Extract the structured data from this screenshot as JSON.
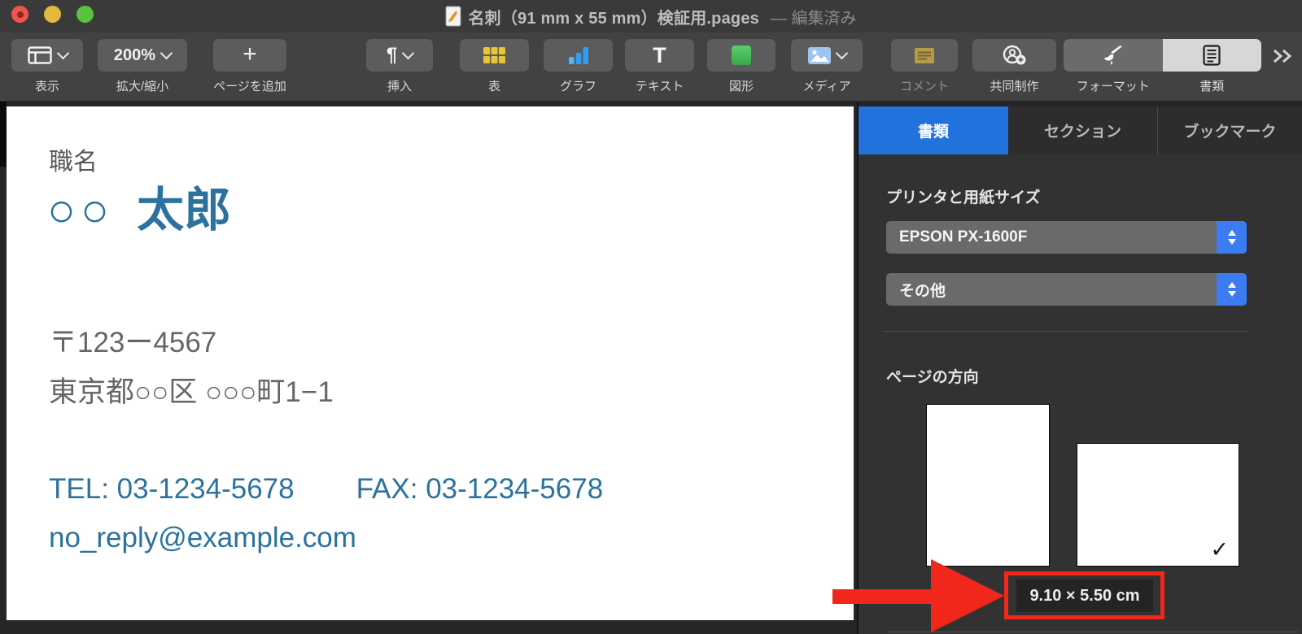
{
  "window": {
    "title": "名刺（91 mm x 55 mm）検証用.pages",
    "edited_suffix": "— 編集済み"
  },
  "toolbar": {
    "view": {
      "label": "表示"
    },
    "zoom": {
      "label": "拡大/縮小",
      "value": "200%"
    },
    "add_page": {
      "label": "ページを追加",
      "glyph": "+"
    },
    "insert": {
      "label": "挿入",
      "glyph": "¶"
    },
    "table": {
      "label": "表"
    },
    "chart": {
      "label": "グラフ"
    },
    "text": {
      "label": "テキスト",
      "glyph": "T"
    },
    "shape": {
      "label": "図形"
    },
    "media": {
      "label": "メディア"
    },
    "comment": {
      "label": "コメント"
    },
    "collaborate": {
      "label": "共同制作"
    },
    "format": {
      "label": "フォーマット"
    },
    "document": {
      "label": "書類"
    }
  },
  "page": {
    "job_title": "職名",
    "name_circles": "○○",
    "name": "太郎",
    "postal_code": "〒123ー4567",
    "address": "東京都○○区 ○○○町1−1",
    "tel": "TEL: 03-1234-5678",
    "fax": "FAX: 03-1234-5678",
    "email": "no_reply@example.com"
  },
  "sidebar": {
    "tabs": [
      {
        "label": "書類"
      },
      {
        "label": "セクション"
      },
      {
        "label": "ブックマーク"
      }
    ],
    "printer_section_label": "プリンタと用紙サイズ",
    "printer_name": "EPSON PX-1600F",
    "paper_size_option": "その他",
    "orientation_label": "ページの方向",
    "landscape_check": "✓",
    "page_size": "9.10 × 5.50 cm"
  },
  "colors": {
    "tab_active_blue": "#2272de",
    "select_cap_blue": "#3b7cf3",
    "document_text_blue": "#2b729e",
    "annotation_red": "#f2271c"
  }
}
